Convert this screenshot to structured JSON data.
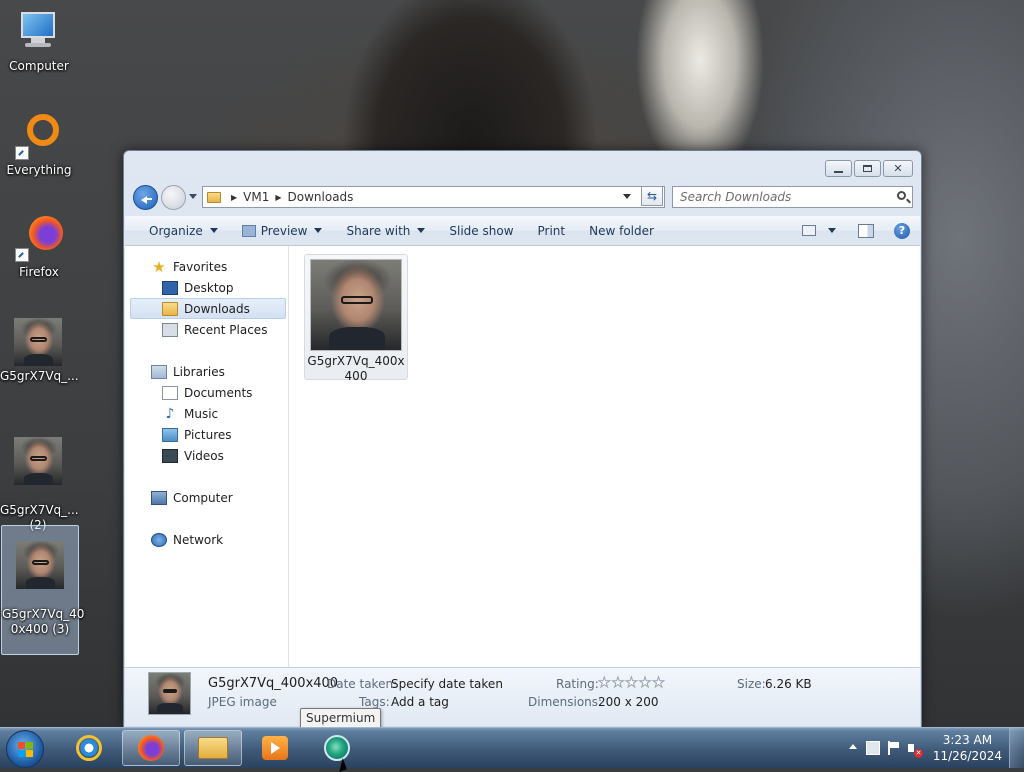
{
  "desktop": {
    "icons": [
      {
        "label": "Computer"
      },
      {
        "label": "Everything"
      },
      {
        "label": "Firefox"
      },
      {
        "label": "G5grX7Vq_..."
      },
      {
        "label": "G5grX7Vq_...\n(2)"
      },
      {
        "label": "G5grX7Vq_40\n0x400 (3)"
      }
    ]
  },
  "window": {
    "caption_buttons": [
      "minimize-icon",
      "maximize-icon",
      "close-icon"
    ],
    "address": {
      "crumbs": [
        "VM1",
        "Downloads"
      ]
    },
    "search": {
      "placeholder": "Search Downloads"
    },
    "toolbar": {
      "organize": "Organize",
      "preview": "Preview",
      "share_with": "Share with",
      "slide_show": "Slide show",
      "print": "Print",
      "new_folder": "New folder"
    },
    "nav": {
      "favorites": "Favorites",
      "desktop": "Desktop",
      "downloads": "Downloads",
      "recent_places": "Recent Places",
      "libraries": "Libraries",
      "documents": "Documents",
      "music": "Music",
      "pictures": "Pictures",
      "videos": "Videos",
      "computer": "Computer",
      "network": "Network"
    },
    "files": [
      {
        "name": "G5grX7Vq_400x400"
      }
    ],
    "details": {
      "filename": "G5grX7Vq_400x400",
      "type": "JPEG image",
      "date_taken_label": "Date taken:",
      "date_taken_value": "Specify date taken",
      "tags_label": "Tags:",
      "tags_value": "Add a tag",
      "rating_label": "Rating:",
      "rating_stars": 0,
      "rating_max": 5,
      "dimensions_label": "Dimensions:",
      "dimensions_value": "200 x 200",
      "size_label": "Size:",
      "size_value": "6.26 KB"
    }
  },
  "tooltip": {
    "text": "Supermium"
  },
  "taskbar": {
    "apps": [
      "internet-explorer-icon",
      "firefox-icon",
      "file-explorer-icon",
      "media-player-icon",
      "supermium-icon"
    ],
    "clock": {
      "time": "3:23 AM",
      "date": "11/26/2024"
    }
  }
}
